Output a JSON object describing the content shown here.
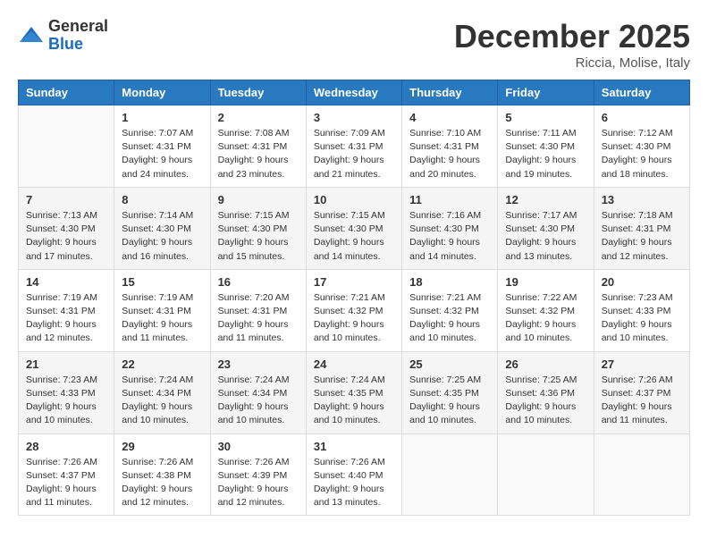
{
  "header": {
    "logo_general": "General",
    "logo_blue": "Blue",
    "month_title": "December 2025",
    "subtitle": "Riccia, Molise, Italy"
  },
  "weekdays": [
    "Sunday",
    "Monday",
    "Tuesday",
    "Wednesday",
    "Thursday",
    "Friday",
    "Saturday"
  ],
  "weeks": [
    [
      {
        "day": "",
        "info": ""
      },
      {
        "day": "1",
        "info": "Sunrise: 7:07 AM\nSunset: 4:31 PM\nDaylight: 9 hours\nand 24 minutes."
      },
      {
        "day": "2",
        "info": "Sunrise: 7:08 AM\nSunset: 4:31 PM\nDaylight: 9 hours\nand 23 minutes."
      },
      {
        "day": "3",
        "info": "Sunrise: 7:09 AM\nSunset: 4:31 PM\nDaylight: 9 hours\nand 21 minutes."
      },
      {
        "day": "4",
        "info": "Sunrise: 7:10 AM\nSunset: 4:31 PM\nDaylight: 9 hours\nand 20 minutes."
      },
      {
        "day": "5",
        "info": "Sunrise: 7:11 AM\nSunset: 4:30 PM\nDaylight: 9 hours\nand 19 minutes."
      },
      {
        "day": "6",
        "info": "Sunrise: 7:12 AM\nSunset: 4:30 PM\nDaylight: 9 hours\nand 18 minutes."
      }
    ],
    [
      {
        "day": "7",
        "info": "Sunrise: 7:13 AM\nSunset: 4:30 PM\nDaylight: 9 hours\nand 17 minutes."
      },
      {
        "day": "8",
        "info": "Sunrise: 7:14 AM\nSunset: 4:30 PM\nDaylight: 9 hours\nand 16 minutes."
      },
      {
        "day": "9",
        "info": "Sunrise: 7:15 AM\nSunset: 4:30 PM\nDaylight: 9 hours\nand 15 minutes."
      },
      {
        "day": "10",
        "info": "Sunrise: 7:15 AM\nSunset: 4:30 PM\nDaylight: 9 hours\nand 14 minutes."
      },
      {
        "day": "11",
        "info": "Sunrise: 7:16 AM\nSunset: 4:30 PM\nDaylight: 9 hours\nand 14 minutes."
      },
      {
        "day": "12",
        "info": "Sunrise: 7:17 AM\nSunset: 4:30 PM\nDaylight: 9 hours\nand 13 minutes."
      },
      {
        "day": "13",
        "info": "Sunrise: 7:18 AM\nSunset: 4:31 PM\nDaylight: 9 hours\nand 12 minutes."
      }
    ],
    [
      {
        "day": "14",
        "info": "Sunrise: 7:19 AM\nSunset: 4:31 PM\nDaylight: 9 hours\nand 12 minutes."
      },
      {
        "day": "15",
        "info": "Sunrise: 7:19 AM\nSunset: 4:31 PM\nDaylight: 9 hours\nand 11 minutes."
      },
      {
        "day": "16",
        "info": "Sunrise: 7:20 AM\nSunset: 4:31 PM\nDaylight: 9 hours\nand 11 minutes."
      },
      {
        "day": "17",
        "info": "Sunrise: 7:21 AM\nSunset: 4:32 PM\nDaylight: 9 hours\nand 10 minutes."
      },
      {
        "day": "18",
        "info": "Sunrise: 7:21 AM\nSunset: 4:32 PM\nDaylight: 9 hours\nand 10 minutes."
      },
      {
        "day": "19",
        "info": "Sunrise: 7:22 AM\nSunset: 4:32 PM\nDaylight: 9 hours\nand 10 minutes."
      },
      {
        "day": "20",
        "info": "Sunrise: 7:23 AM\nSunset: 4:33 PM\nDaylight: 9 hours\nand 10 minutes."
      }
    ],
    [
      {
        "day": "21",
        "info": "Sunrise: 7:23 AM\nSunset: 4:33 PM\nDaylight: 9 hours\nand 10 minutes."
      },
      {
        "day": "22",
        "info": "Sunrise: 7:24 AM\nSunset: 4:34 PM\nDaylight: 9 hours\nand 10 minutes."
      },
      {
        "day": "23",
        "info": "Sunrise: 7:24 AM\nSunset: 4:34 PM\nDaylight: 9 hours\nand 10 minutes."
      },
      {
        "day": "24",
        "info": "Sunrise: 7:24 AM\nSunset: 4:35 PM\nDaylight: 9 hours\nand 10 minutes."
      },
      {
        "day": "25",
        "info": "Sunrise: 7:25 AM\nSunset: 4:35 PM\nDaylight: 9 hours\nand 10 minutes."
      },
      {
        "day": "26",
        "info": "Sunrise: 7:25 AM\nSunset: 4:36 PM\nDaylight: 9 hours\nand 10 minutes."
      },
      {
        "day": "27",
        "info": "Sunrise: 7:26 AM\nSunset: 4:37 PM\nDaylight: 9 hours\nand 11 minutes."
      }
    ],
    [
      {
        "day": "28",
        "info": "Sunrise: 7:26 AM\nSunset: 4:37 PM\nDaylight: 9 hours\nand 11 minutes."
      },
      {
        "day": "29",
        "info": "Sunrise: 7:26 AM\nSunset: 4:38 PM\nDaylight: 9 hours\nand 12 minutes."
      },
      {
        "day": "30",
        "info": "Sunrise: 7:26 AM\nSunset: 4:39 PM\nDaylight: 9 hours\nand 12 minutes."
      },
      {
        "day": "31",
        "info": "Sunrise: 7:26 AM\nSunset: 4:40 PM\nDaylight: 9 hours\nand 13 minutes."
      },
      {
        "day": "",
        "info": ""
      },
      {
        "day": "",
        "info": ""
      },
      {
        "day": "",
        "info": ""
      }
    ]
  ]
}
